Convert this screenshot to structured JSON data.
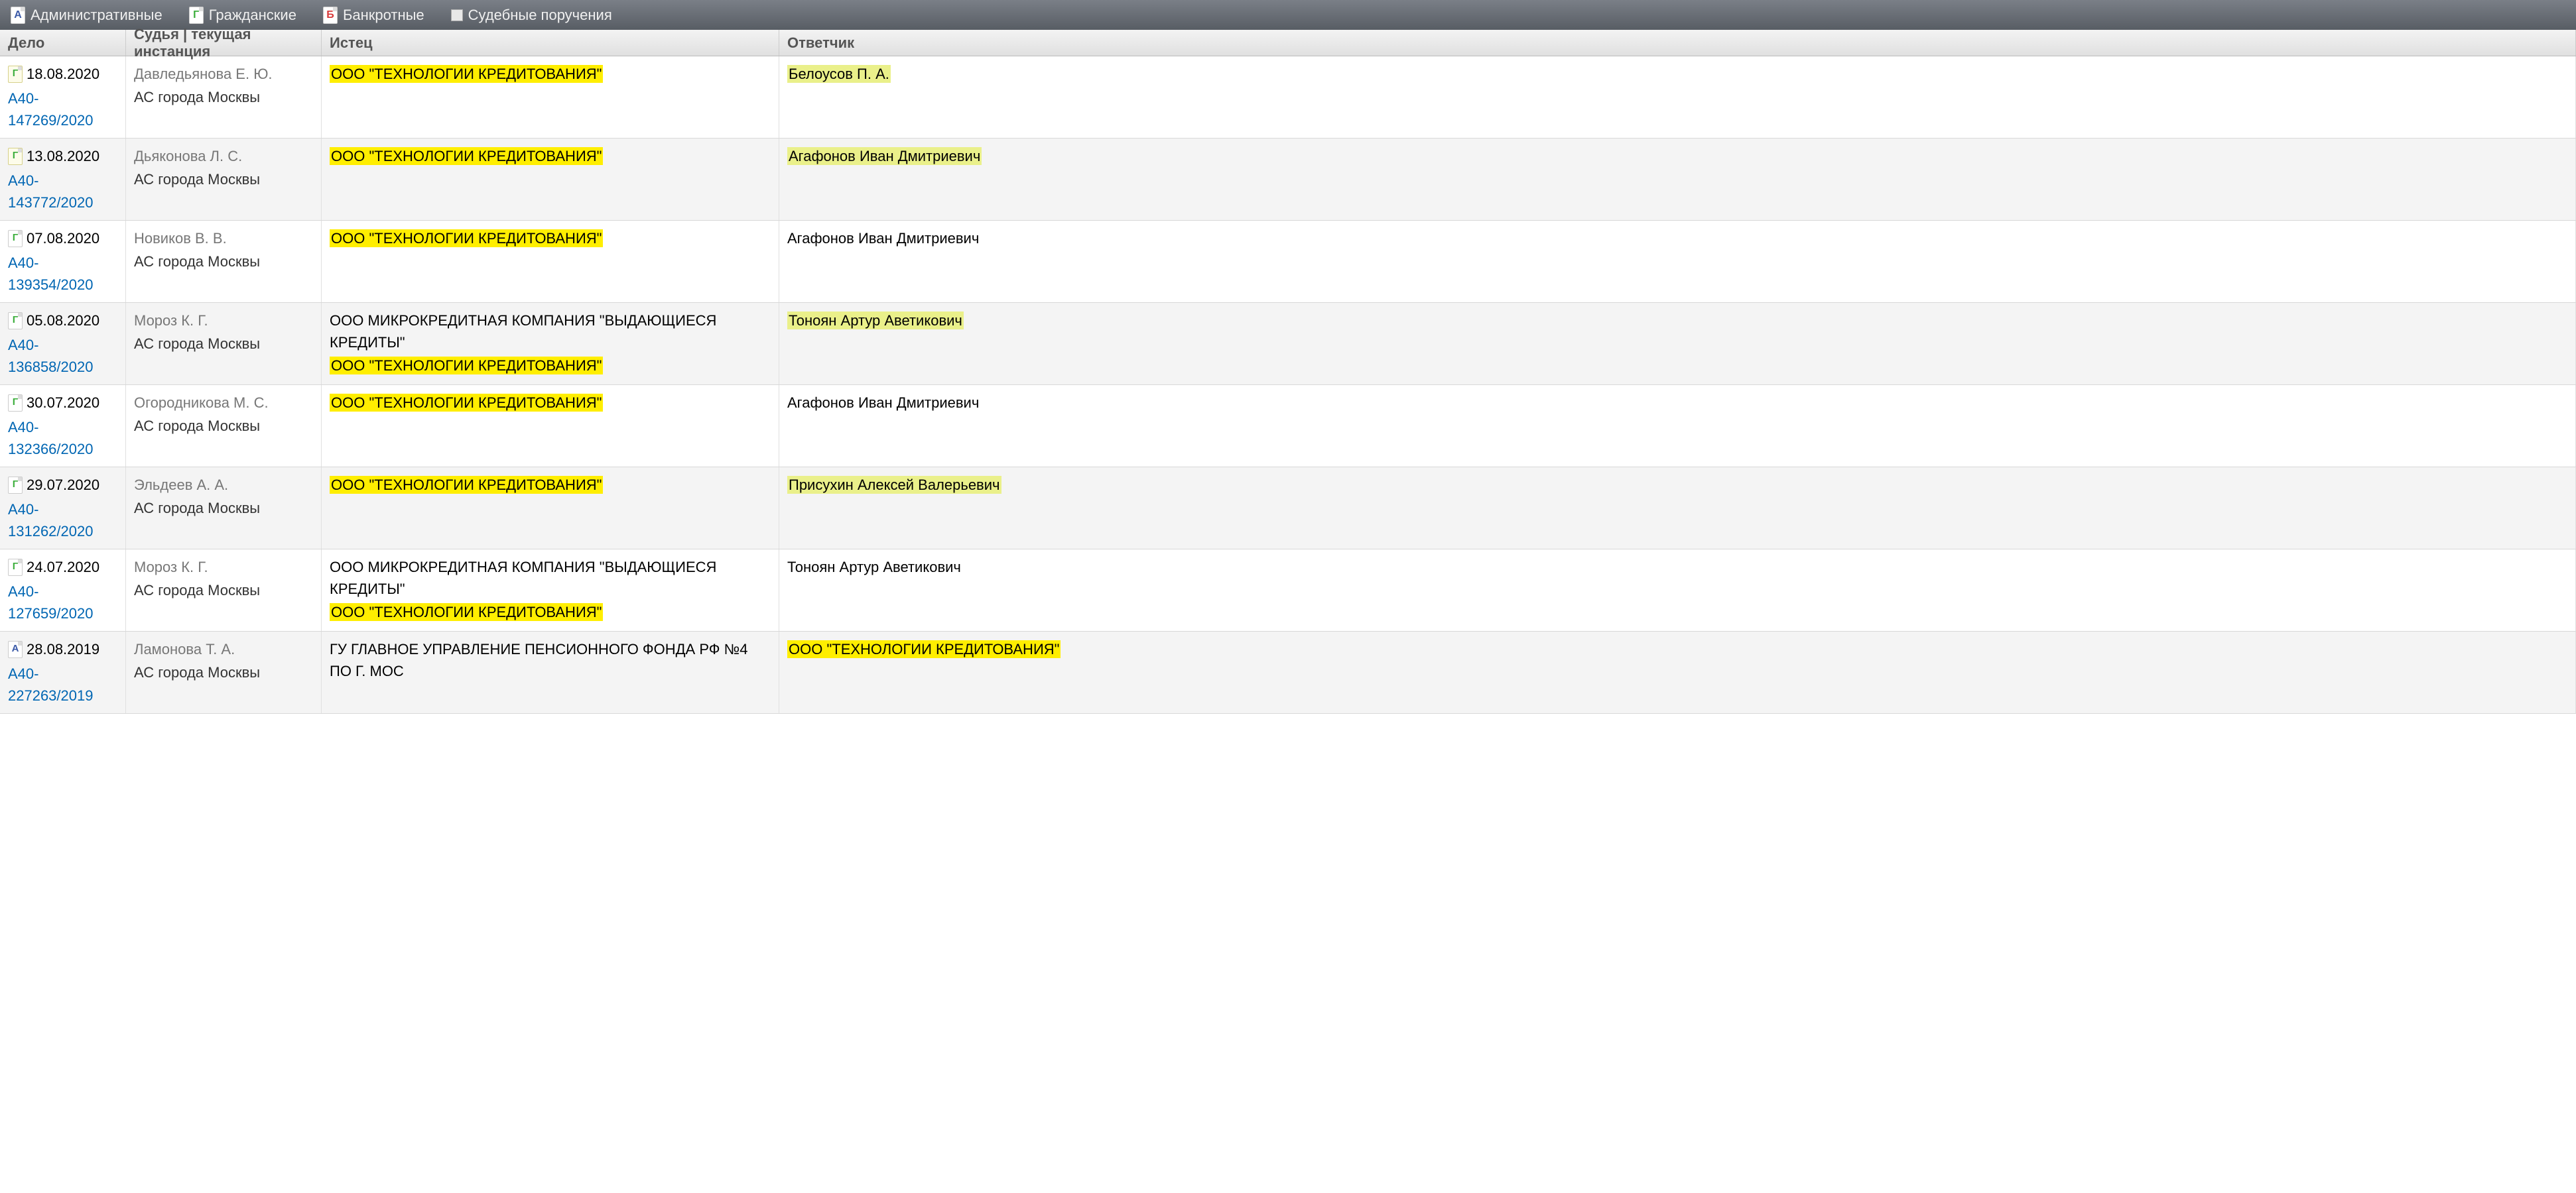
{
  "toolbar": {
    "filters": [
      {
        "icon": "А",
        "icon_class": "icon-a",
        "label": "Административные"
      },
      {
        "icon": "Г",
        "icon_class": "icon-g",
        "label": "Гражданские"
      },
      {
        "icon": "Б",
        "icon_class": "icon-b",
        "label": "Банкротные"
      }
    ],
    "checkbox_label": "Судебные поручения"
  },
  "headers": {
    "case": "Дело",
    "judge": "Судья | текущая инстанция",
    "plaintiff": "Истец",
    "defendant": "Ответчик"
  },
  "rows": [
    {
      "icon_type": "Г",
      "icon_simple": true,
      "date": "18.08.2020",
      "number": "А40-147269/2020",
      "judge": "Давледьянова Е. Ю.",
      "court": "АС города Москвы",
      "plaintiffs": [
        {
          "text": "ООО \"ТЕХНОЛОГИИ КРЕДИТОВАНИЯ\"",
          "hl": "yellow"
        }
      ],
      "defendants": [
        {
          "text": "Белоусов П. А.",
          "hl": "lime"
        }
      ]
    },
    {
      "icon_type": "Г",
      "icon_simple": true,
      "date": "13.08.2020",
      "number": "А40-143772/2020",
      "judge": "Дьяконова Л. С.",
      "court": "АС города Москвы",
      "plaintiffs": [
        {
          "text": "ООО \"ТЕХНОЛОГИИ КРЕДИТОВАНИЯ\"",
          "hl": "yellow"
        }
      ],
      "defendants": [
        {
          "text": "Агафонов Иван Дмитриевич",
          "hl": "lime"
        }
      ]
    },
    {
      "icon_type": "Г",
      "icon_simple": false,
      "date": "07.08.2020",
      "number": "А40-139354/2020",
      "judge": "Новиков В. В.",
      "court": "АС города Москвы",
      "plaintiffs": [
        {
          "text": "ООО \"ТЕХНОЛОГИИ КРЕДИТОВАНИЯ\"",
          "hl": "yellow"
        }
      ],
      "defendants": [
        {
          "text": "Агафонов Иван Дмитриевич",
          "hl": "none"
        }
      ]
    },
    {
      "icon_type": "Г",
      "icon_simple": false,
      "date": "05.08.2020",
      "number": "А40-136858/2020",
      "judge": "Мороз К. Г.",
      "court": "АС города Москвы",
      "plaintiffs": [
        {
          "text": "ООО МИКРОКРЕДИТНАЯ КОМПАНИЯ \"ВЫДАЮЩИЕСЯ КРЕДИТЫ\"",
          "hl": "none"
        },
        {
          "text": "ООО \"ТЕХНОЛОГИИ КРЕДИТОВАНИЯ\"",
          "hl": "yellow"
        }
      ],
      "defendants": [
        {
          "text": "Тоноян Артур Аветикович",
          "hl": "lime"
        }
      ]
    },
    {
      "icon_type": "Г",
      "icon_simple": false,
      "date": "30.07.2020",
      "number": "А40-132366/2020",
      "judge": "Огородникова М. С.",
      "court": "АС города Москвы",
      "plaintiffs": [
        {
          "text": "ООО \"ТЕХНОЛОГИИ КРЕДИТОВАНИЯ\"",
          "hl": "yellow"
        }
      ],
      "defendants": [
        {
          "text": "Агафонов Иван Дмитриевич",
          "hl": "none"
        }
      ]
    },
    {
      "icon_type": "Г",
      "icon_simple": false,
      "date": "29.07.2020",
      "number": "А40-131262/2020",
      "judge": "Эльдеев А. А.",
      "court": "АС города Москвы",
      "plaintiffs": [
        {
          "text": "ООО \"ТЕХНОЛОГИИ КРЕДИТОВАНИЯ\"",
          "hl": "yellow"
        }
      ],
      "defendants": [
        {
          "text": "Присухин Алексей Валерьевич",
          "hl": "lime"
        }
      ]
    },
    {
      "icon_type": "Г",
      "icon_simple": false,
      "date": "24.07.2020",
      "number": "А40-127659/2020",
      "judge": "Мороз К. Г.",
      "court": "АС города Москвы",
      "plaintiffs": [
        {
          "text": "ООО МИКРОКРЕДИТНАЯ КОМПАНИЯ \"ВЫДАЮЩИЕСЯ КРЕДИТЫ\"",
          "hl": "none"
        },
        {
          "text": "ООО \"ТЕХНОЛОГИИ КРЕДИТОВАНИЯ\"",
          "hl": "yellow"
        }
      ],
      "defendants": [
        {
          "text": "Тоноян Артур Аветикович",
          "hl": "none"
        }
      ]
    },
    {
      "icon_type": "А",
      "icon_simple": false,
      "date": "28.08.2019",
      "number": "А40-227263/2019",
      "judge": "Ламонова Т. А.",
      "court": "АС города Москвы",
      "plaintiffs": [
        {
          "text": "ГУ ГЛАВНОЕ УПРАВЛЕНИЕ ПЕНСИОННОГО ФОНДА РФ №4 ПО Г. МОС",
          "hl": "none"
        }
      ],
      "defendants": [
        {
          "text": "ООО \"ТЕХНОЛОГИИ КРЕДИТОВАНИЯ\"",
          "hl": "yellow"
        }
      ]
    }
  ]
}
